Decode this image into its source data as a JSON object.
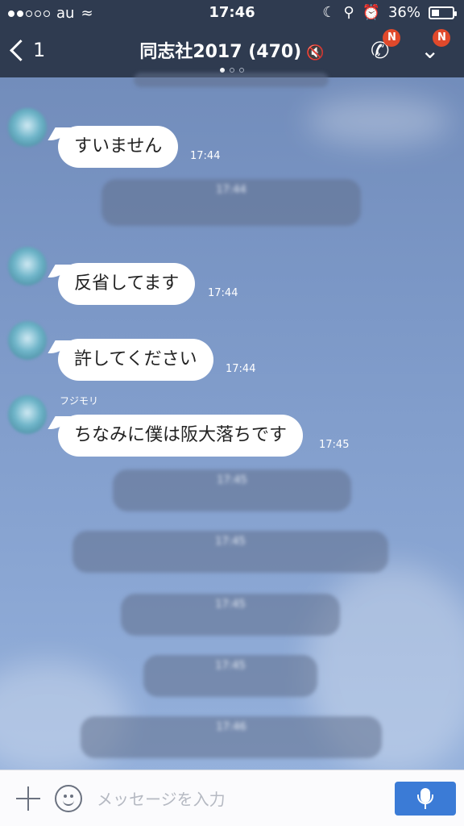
{
  "status_bar": {
    "carrier": "au",
    "time": "17:46",
    "battery": "36%",
    "battery_level": 0.36
  },
  "header": {
    "back_count": "1",
    "title": "同志社2017 (470)",
    "badge_call": "N",
    "badge_menu": "N"
  },
  "messages": [
    {
      "text": "すいません",
      "time": "17:44"
    },
    {
      "text": "反省してます",
      "time": "17:44"
    },
    {
      "text": "許してください",
      "time": "17:44"
    },
    {
      "sender": "フジモリ",
      "text": "ちなみに僕は阪大落ちです",
      "time": "17:45"
    }
  ],
  "system_times": [
    "17:44",
    "17:45",
    "17:45",
    "17:45",
    "17:45",
    "17:46"
  ],
  "input_bar": {
    "placeholder": "メッセージを入力"
  },
  "colors": {
    "header_bg": "#2f3b50",
    "chat_bg": "#7b97c6",
    "accent": "#3b7bd6",
    "badge": "#e0492b"
  }
}
